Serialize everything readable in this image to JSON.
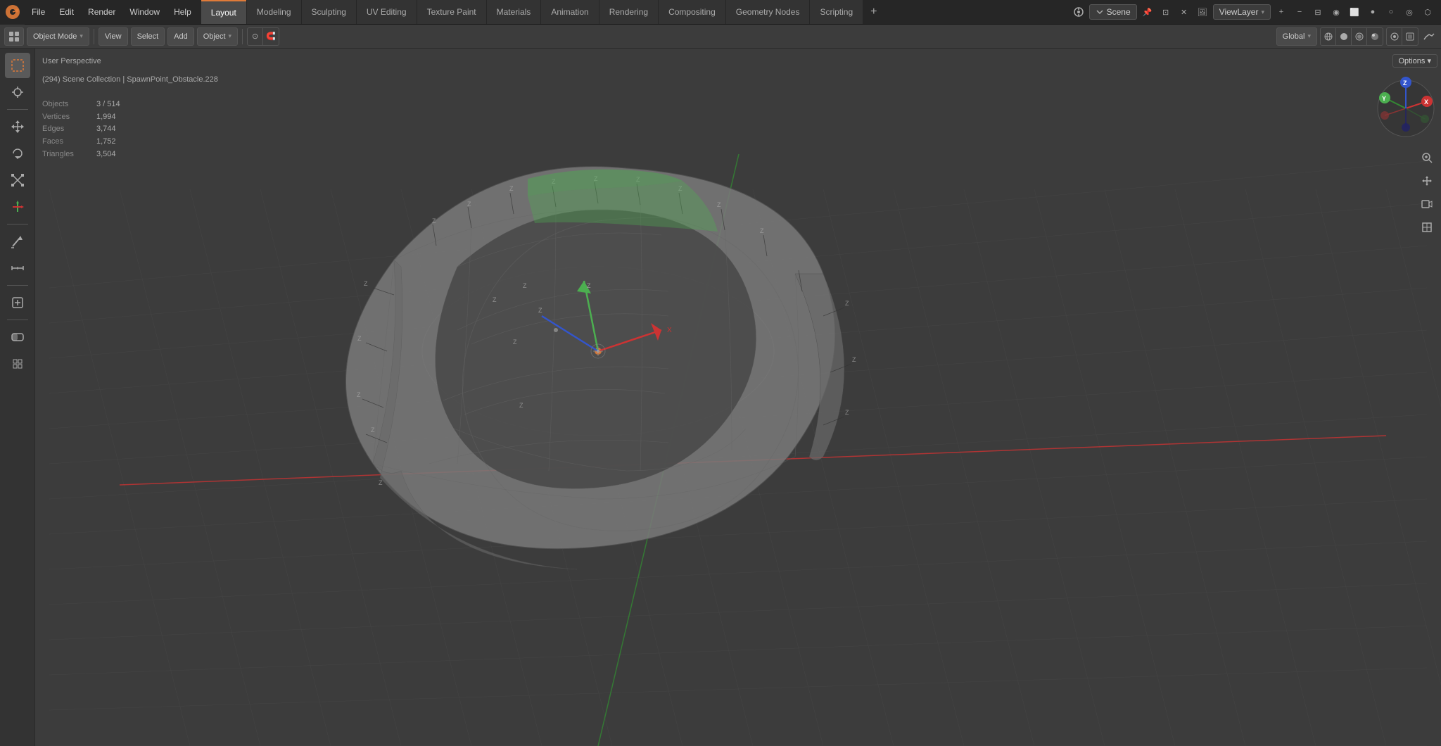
{
  "topMenu": {
    "logo": "⬡",
    "items": [
      "File",
      "Edit",
      "Render",
      "Window",
      "Help"
    ],
    "activeWorkspace": "Layout",
    "workspaceTabs": [
      {
        "label": "Layout",
        "active": true
      },
      {
        "label": "Modeling",
        "active": false
      },
      {
        "label": "Sculpting",
        "active": false
      },
      {
        "label": "UV Editing",
        "active": false
      },
      {
        "label": "Texture Paint",
        "active": false
      },
      {
        "label": "Materials",
        "active": false
      },
      {
        "label": "Animation",
        "active": false
      },
      {
        "label": "Rendering",
        "active": false
      },
      {
        "label": "Compositing",
        "active": false
      },
      {
        "label": "Geometry Nodes",
        "active": false
      },
      {
        "label": "Scripting",
        "active": false
      }
    ],
    "scene": "Scene",
    "viewLayer": "ViewLayer"
  },
  "secondToolbar": {
    "editorType": "⊞",
    "objectMode": "Object Mode",
    "view": "View",
    "select": "Select",
    "add": "Add",
    "object": "Object",
    "global": "Global",
    "options": "Options ▾"
  },
  "leftTools": [
    {
      "icon": "↖",
      "name": "select",
      "active": true
    },
    {
      "icon": "✛",
      "name": "cursor"
    },
    {
      "icon": "⤢",
      "name": "move"
    },
    {
      "icon": "↻",
      "name": "rotate"
    },
    {
      "icon": "⤡",
      "name": "scale"
    },
    {
      "icon": "⊞",
      "name": "transform"
    },
    {
      "separator": true
    },
    {
      "icon": "✎",
      "name": "annotate"
    },
    {
      "icon": "◿",
      "name": "measure"
    },
    {
      "separator": true
    },
    {
      "icon": "⬡",
      "name": "add-cube"
    },
    {
      "separator": true
    },
    {
      "icon": "◧",
      "name": "mask"
    },
    {
      "icon": "▱",
      "name": "lattice"
    }
  ],
  "viewport": {
    "viewTitle": "User Perspective",
    "sceneInfo": "(294) Scene Collection | SpawnPoint_Obstacle.228",
    "stats": {
      "objects": {
        "label": "Objects",
        "value": "3 / 514"
      },
      "vertices": {
        "label": "Vertices",
        "value": "1,994"
      },
      "edges": {
        "label": "Edges",
        "value": "3,744"
      },
      "faces": {
        "label": "Faces",
        "value": "1,752"
      },
      "triangles": {
        "label": "Triangles",
        "value": "3,504"
      }
    }
  },
  "rightTools": [
    {
      "icon": "🔍",
      "name": "zoom"
    },
    {
      "icon": "✋",
      "name": "pan"
    },
    {
      "icon": "🎬",
      "name": "camera"
    },
    {
      "icon": "⬛",
      "name": "orthographic"
    }
  ],
  "gizmo": {
    "y_label": "Y",
    "x_label": "X",
    "z_label": "Z",
    "neg_y_label": "-Y",
    "neg_x_label": "-X",
    "neg_z_label": "-Z"
  },
  "optionsBtn": "Options ▾",
  "colors": {
    "accent": "#e07b39",
    "bg_dark": "#262626",
    "bg_mid": "#333333",
    "bg_light": "#3c3c3c",
    "text": "#cccccc",
    "grid": "#444444",
    "axis_x": "#cc3333",
    "axis_y": "#338833",
    "axis_z": "#3355cc"
  }
}
